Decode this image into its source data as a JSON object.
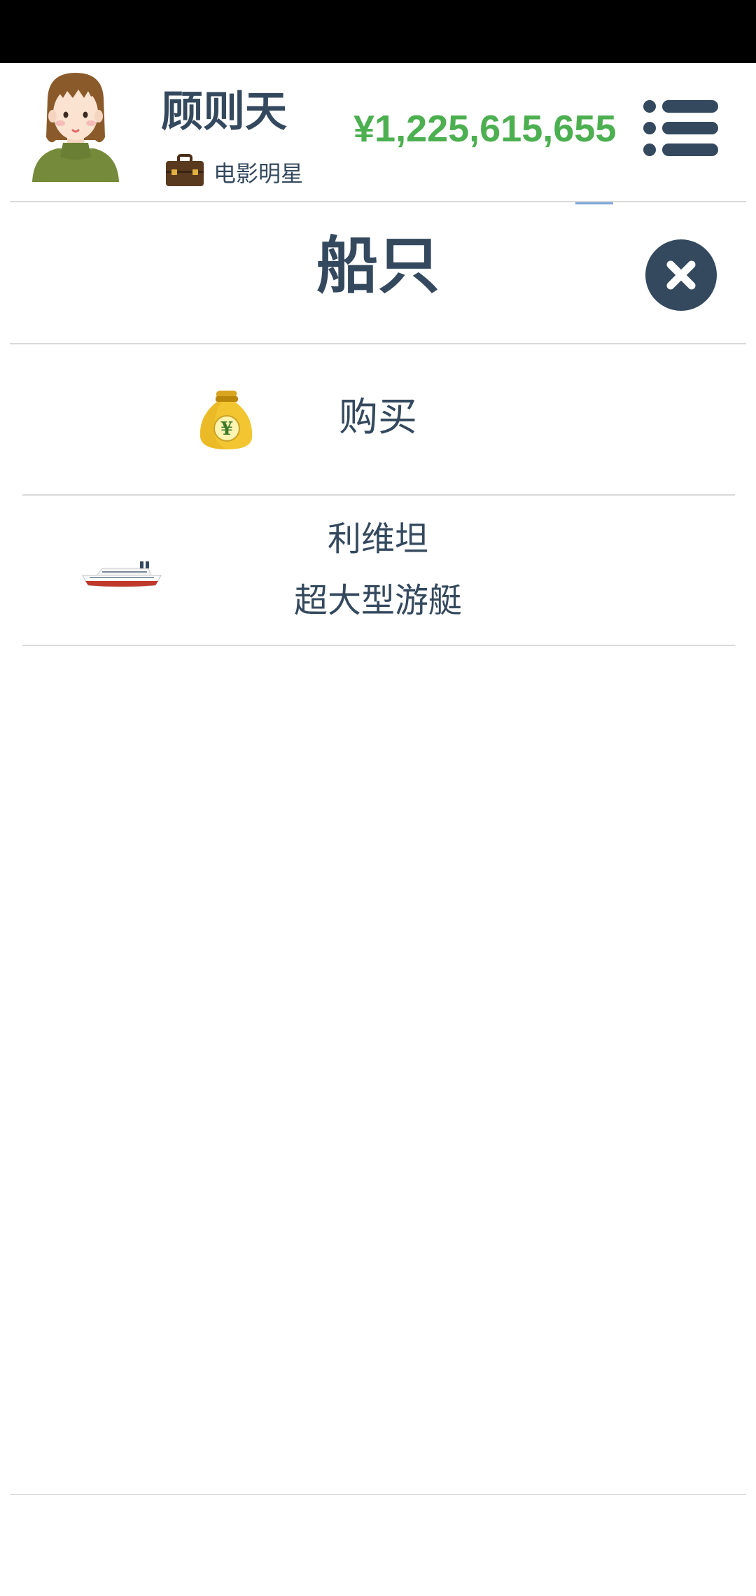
{
  "player": {
    "name": "顾则天",
    "job": "电影明星",
    "money": "¥1,225,615,655"
  },
  "icons": {
    "avatar": "woman-avatar",
    "job": "briefcase-icon",
    "menu": "list-menu-icon",
    "close": "close-x-icon",
    "buy": "money-bag-yen-icon",
    "ship": "cruise-ship-icon"
  },
  "colors": {
    "text": "#34495e",
    "money": "#4caf50",
    "close_bg": "#34495e",
    "divider": "#d9d9d9"
  },
  "panel": {
    "title": "船只"
  },
  "actions": {
    "buy_label": "购买"
  },
  "ships": [
    {
      "name": "利维坦",
      "type": "超大型游艇"
    }
  ]
}
